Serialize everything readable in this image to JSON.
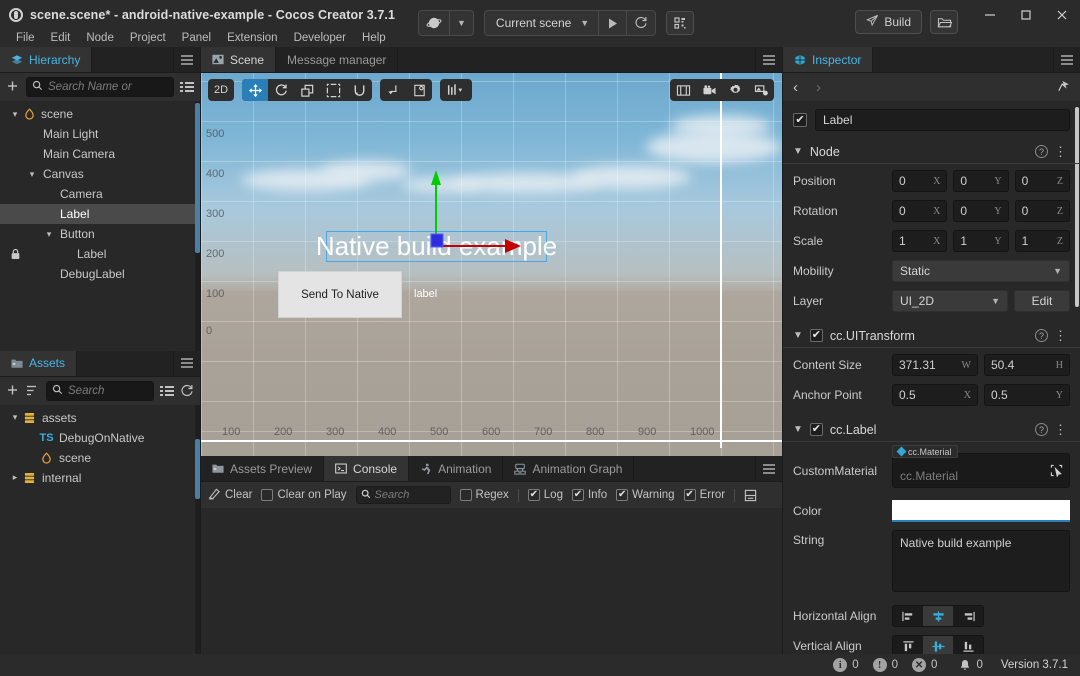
{
  "window": {
    "title": "scene.scene* - android-native-example - Cocos Creator 3.7.1",
    "logo_icon": "cocos-logo-icon",
    "minimize_icon": "minimize-icon",
    "maximize_icon": "maximize-icon",
    "close_icon": "close-icon"
  },
  "menubar": {
    "items": [
      {
        "label": "File"
      },
      {
        "label": "Edit"
      },
      {
        "label": "Node"
      },
      {
        "label": "Project"
      },
      {
        "label": "Panel"
      },
      {
        "label": "Extension"
      },
      {
        "label": "Developer"
      },
      {
        "label": "Help"
      }
    ]
  },
  "toolbar": {
    "preview_device_icon": "cocos-preview-icon",
    "preview_device_chevron": "chevron-down-icon",
    "scene_selector_value": "Current scene",
    "scene_selector_chevron": "chevron-down-icon",
    "play_icon": "play-icon",
    "refresh_icon": "refresh-icon",
    "qr_icon": "qr-code-icon",
    "build_label": "Build",
    "build_icon": "paper-plane-icon",
    "open_folder_icon": "folder-open-icon"
  },
  "hierarchy": {
    "tab_label": "Hierarchy",
    "tab_icon": "layers-icon",
    "menu_icon": "hamburger-icon",
    "add_icon": "add-node-icon",
    "search_placeholder": "Search Name or ",
    "search_value": "",
    "search_icon": "search-icon",
    "list_view_icon": "list-view-icon",
    "nodes": [
      {
        "label": "scene",
        "depth": 0,
        "arrow": "chevron-down-icon",
        "icon": "scene-icon",
        "selected": false,
        "locked": false
      },
      {
        "label": "Main Light",
        "depth": 1,
        "arrow": "",
        "icon": "",
        "selected": false,
        "locked": false
      },
      {
        "label": "Main Camera",
        "depth": 1,
        "arrow": "",
        "icon": "",
        "selected": false,
        "locked": false
      },
      {
        "label": "Canvas",
        "depth": 1,
        "arrow": "chevron-down-icon",
        "icon": "",
        "selected": false,
        "locked": false
      },
      {
        "label": "Camera",
        "depth": 2,
        "arrow": "",
        "icon": "",
        "selected": false,
        "locked": false
      },
      {
        "label": "Label",
        "depth": 2,
        "arrow": "",
        "icon": "",
        "selected": true,
        "locked": false
      },
      {
        "label": "Button",
        "depth": 2,
        "arrow": "chevron-down-icon",
        "icon": "",
        "selected": false,
        "locked": false
      },
      {
        "label": "Label",
        "depth": 3,
        "arrow": "",
        "icon": "",
        "selected": false,
        "locked": true
      },
      {
        "label": "DebugLabel",
        "depth": 2,
        "arrow": "",
        "icon": "",
        "selected": false,
        "locked": false
      }
    ]
  },
  "assets": {
    "tab_label": "Assets",
    "tab_icon": "folder-icon",
    "menu_icon": "hamburger-icon",
    "add_icon": "add-asset-icon",
    "sort_icon": "sort-icon",
    "search_placeholder": "Search",
    "search_value": "",
    "search_icon": "search-icon",
    "list_view_icon": "list-view-icon",
    "refresh_icon": "refresh-icon",
    "items": [
      {
        "label": "assets",
        "depth": 0,
        "arrow": "chevron-down-icon",
        "icon": "db-icon",
        "icon_text": ""
      },
      {
        "label": "DebugOnNative",
        "depth": 1,
        "arrow": "",
        "icon": "ts-icon",
        "icon_text": "TS"
      },
      {
        "label": "scene",
        "depth": 1,
        "arrow": "",
        "icon": "scene-icon",
        "icon_text": ""
      },
      {
        "label": "internal",
        "depth": 0,
        "arrow": "chevron-right-icon",
        "icon": "db-icon",
        "icon_text": ""
      }
    ]
  },
  "scene_panel": {
    "tabs": [
      {
        "label": "Scene",
        "icon": "scene-tab-icon",
        "active": true
      },
      {
        "label": "Message manager",
        "icon": "",
        "active": false
      }
    ],
    "menu_icon": "hamburger-icon",
    "toolbar": {
      "mode_label": "2D",
      "transform_tools": [
        {
          "name": "move-tool",
          "icon": "move-icon",
          "active": true
        },
        {
          "name": "rotate-tool",
          "icon": "rotate-icon",
          "active": false
        },
        {
          "name": "scale-tool",
          "icon": "scale-icon",
          "active": false
        },
        {
          "name": "rect-tool",
          "icon": "rect-transform-icon",
          "active": false
        },
        {
          "name": "magnet-tool",
          "icon": "magnet-icon",
          "active": false
        }
      ],
      "pivot_tools": [
        {
          "name": "pivot-tool",
          "icon": "pivot-icon"
        },
        {
          "name": "coordinate-tool",
          "icon": "coordinate-icon"
        }
      ],
      "gizmo_tools": [
        {
          "name": "gizmo-settings",
          "icon": "gizmo-bars-icon"
        }
      ],
      "right_tools": [
        {
          "name": "grid-toggle",
          "icon": "grid-icon"
        },
        {
          "name": "camera-align",
          "icon": "camera-icon"
        },
        {
          "name": "scene-settings",
          "icon": "gear-icon"
        },
        {
          "name": "scene-effects",
          "icon": "effects-icon"
        }
      ]
    },
    "rulers": {
      "y_labels": [
        "500",
        "400",
        "300",
        "200",
        "100",
        "0"
      ],
      "x_labels": [
        "100",
        "200",
        "300",
        "400",
        "500",
        "600",
        "700",
        "800",
        "900",
        "1000"
      ]
    },
    "nodes": {
      "label_text": "Native build example",
      "button_text": "Send To Native",
      "debug_label_text": "label"
    },
    "gizmo": {
      "x_axis_color": "#d40000",
      "y_axis_color": "#00d400",
      "center_color": "#2a2ae0"
    }
  },
  "console_panel": {
    "tabs": [
      {
        "label": "Assets Preview",
        "icon": "assets-preview-icon",
        "active": false
      },
      {
        "label": "Console",
        "icon": "console-icon",
        "active": true
      },
      {
        "label": "Animation",
        "icon": "animation-icon",
        "active": false
      },
      {
        "label": "Animation Graph",
        "icon": "animation-graph-icon",
        "active": false
      }
    ],
    "menu_icon": "hamburger-icon",
    "toolbar": {
      "clear_label": "Clear",
      "clear_icon": "clear-icon",
      "clear_on_play_label": "Clear on Play",
      "clear_on_play_checked": false,
      "search_placeholder": "Search",
      "search_value": "",
      "search_icon": "search-icon",
      "regex_label": "Regex",
      "regex_checked": false,
      "filters": [
        {
          "label": "Log",
          "checked": true
        },
        {
          "label": "Info",
          "checked": true
        },
        {
          "label": "Warning",
          "checked": true
        },
        {
          "label": "Error",
          "checked": true
        }
      ],
      "collapse_icon": "collapse-icon"
    },
    "messages": []
  },
  "inspector": {
    "tab_label": "Inspector",
    "tab_icon": "inspector-icon",
    "menu_icon": "hamburger-icon",
    "back_icon": "chevron-left-icon",
    "forward_icon": "chevron-right-icon",
    "pin_icon": "pin-icon",
    "node_enabled": true,
    "node_name": "Label",
    "node_section": {
      "title": "Node",
      "caret_icon": "chevron-down-icon",
      "help_icon": "question-icon",
      "kebab_icon": "kebab-menu-icon",
      "position": {
        "label": "Position",
        "x": "0",
        "y": "0",
        "z": "0"
      },
      "rotation": {
        "label": "Rotation",
        "x": "0",
        "y": "0",
        "z": "0"
      },
      "scale": {
        "label": "Scale",
        "x": "1",
        "y": "1",
        "z": "1"
      },
      "mobility": {
        "label": "Mobility",
        "value": "Static"
      },
      "layer": {
        "label": "Layer",
        "value": "UI_2D",
        "edit_label": "Edit"
      },
      "axis_x": "X",
      "axis_y": "Y",
      "axis_z": "Z"
    },
    "ui_transform": {
      "title": "cc.UITransform",
      "enabled": true,
      "caret_icon": "chevron-down-icon",
      "help_icon": "question-icon",
      "kebab_icon": "kebab-menu-icon",
      "content_size": {
        "label": "Content Size",
        "w": "371.31",
        "h": "50.4",
        "w_axis": "W",
        "h_axis": "H"
      },
      "anchor_point": {
        "label": "Anchor Point",
        "x": "0.5",
        "y": "0.5",
        "x_axis": "X",
        "y_axis": "Y"
      }
    },
    "label_component": {
      "title": "cc.Label",
      "enabled": true,
      "caret_icon": "chevron-down-icon",
      "help_icon": "question-icon",
      "kebab_icon": "kebab-menu-icon",
      "custom_material": {
        "label": "CustomMaterial",
        "tag": "cc.Material",
        "placeholder": "cc.Material",
        "pick_icon": "pick-target-icon"
      },
      "color": {
        "label": "Color",
        "value": "#ffffff"
      },
      "string": {
        "label": "String",
        "value": "Native build example"
      },
      "horizontal_align": {
        "label": "Horizontal Align",
        "options": [
          {
            "name": "align-left-icon",
            "active": false
          },
          {
            "name": "align-center-icon",
            "active": true
          },
          {
            "name": "align-right-icon",
            "active": false
          }
        ]
      },
      "vertical_align": {
        "label": "Vertical Align",
        "options": [
          {
            "name": "align-top-icon",
            "active": false
          },
          {
            "name": "align-middle-icon",
            "active": true
          },
          {
            "name": "align-bottom-icon",
            "active": false
          }
        ]
      }
    }
  },
  "statusbar": {
    "info_icon": "info-icon",
    "info_count": "0",
    "warning_icon": "warning-icon",
    "warning_count": "0",
    "error_icon": "error-icon",
    "error_count": "0",
    "bell_icon": "bell-icon",
    "bell_count": "0",
    "version_label": "Version",
    "version_value": "3.7.1"
  }
}
